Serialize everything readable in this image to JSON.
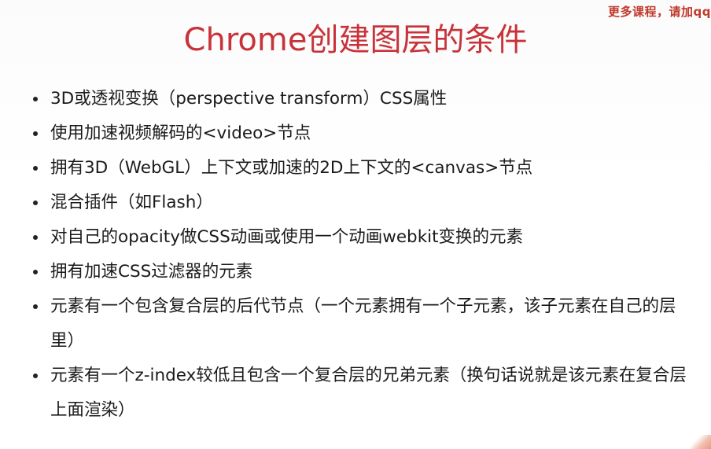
{
  "watermark": "更多课程，请加qq",
  "title": "Chrome创建图层的条件",
  "bullets": [
    "3D或透视变换（perspective transform）CSS属性",
    "使用加速视频解码的<video>节点",
    "拥有3D（WebGL）上下文或加速的2D上下文的<canvas>节点",
    "混合插件（如Flash）",
    "对自己的opacity做CSS动画或使用一个动画webkit变换的元素",
    "拥有加速CSS过滤器的元素",
    "元素有一个包含复合层的后代节点（一个元素拥有一个子元素，该子元素在自己的层里）",
    "元素有一个z-index较低且包含一个复合层的兄弟元素（换句话说就是该元素在复合层上面渲染）"
  ],
  "colors": {
    "title": "#c8333a",
    "watermark": "#c0392b",
    "text": "#1a1a1a"
  }
}
